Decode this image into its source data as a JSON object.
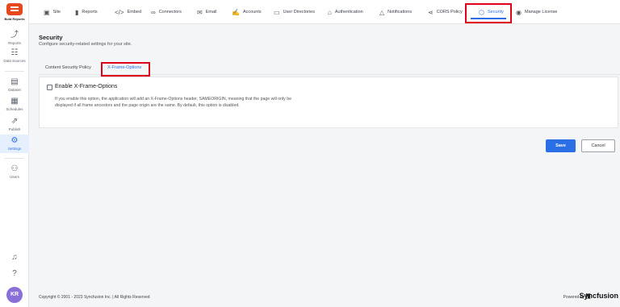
{
  "app": {
    "logo_text": "Bold Reports"
  },
  "rail": {
    "items": [
      {
        "label": "Reports",
        "icon": "chart-line-icon"
      },
      {
        "label": "Data Sources",
        "icon": "data-sources-icon"
      },
      {
        "label": "Dataset",
        "icon": "dataset-icon"
      },
      {
        "label": "Schedules",
        "icon": "calendar-icon"
      },
      {
        "label": "Publish",
        "icon": "publish-icon"
      },
      {
        "label": "Settings",
        "icon": "gear-icon"
      },
      {
        "label": "Users",
        "icon": "users-icon"
      }
    ],
    "active": "Settings",
    "avatar": "KR"
  },
  "topnav": {
    "tabs": [
      {
        "label": "Site",
        "icon": "site-icon"
      },
      {
        "label": "Reports",
        "icon": "bar-chart-icon"
      },
      {
        "label": "Embed",
        "icon": "code-icon"
      },
      {
        "label": "Connectors",
        "icon": "link-icon"
      },
      {
        "label": "Email",
        "icon": "mail-icon"
      },
      {
        "label": "Accounts",
        "icon": "accounts-icon"
      },
      {
        "label": "User Directories",
        "icon": "directory-icon"
      },
      {
        "label": "Authentication",
        "icon": "lock-icon"
      },
      {
        "label": "Notifications",
        "icon": "bell-icon"
      },
      {
        "label": "CORS Policy",
        "icon": "share-icon"
      },
      {
        "label": "Security",
        "icon": "shield-icon"
      },
      {
        "label": "Manage License",
        "icon": "license-icon"
      }
    ],
    "active": "Security"
  },
  "page": {
    "title": "Security",
    "subtitle": "Configure security-related settings for your site."
  },
  "subtabs": {
    "items": [
      "Content Security Policy",
      "X-Frame-Options"
    ],
    "active": "X-Frame-Options"
  },
  "xframe": {
    "checkbox_label": "Enable X-Frame-Options",
    "checked": false,
    "description": "If you enable this option, the application will add an X-Frame-Options header, SAMEORIGIN, meaning that the page will only be displayed if all frame ancestors and the page origin are the same. By default, this option is disabled."
  },
  "actions": {
    "save": "Save",
    "cancel": "Cancel"
  },
  "footer": {
    "copyright": "Copyright © 2001 - 2023 Syncfusion Inc.  |  All Rights Reserved",
    "powered_by": "Powered by",
    "brand": "Syncfusion"
  },
  "colors": {
    "accent": "#2b6fe6",
    "highlight": "#e0001b",
    "brand": "#e8461c"
  }
}
